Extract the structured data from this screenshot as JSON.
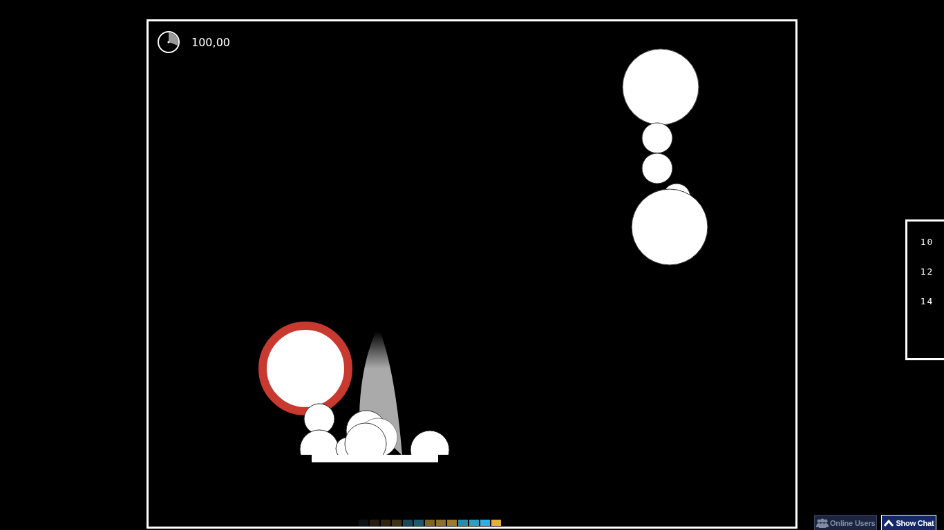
{
  "hud": {
    "timer": "100,00"
  },
  "scores": [
    "10",
    "12",
    "14"
  ],
  "swatches": [
    {
      "color": "#0a1418"
    },
    {
      "color": "#261d10"
    },
    {
      "color": "#2f2612"
    },
    {
      "color": "#3f3216"
    },
    {
      "color": "#1a4a5a"
    },
    {
      "color": "#1e5a6a"
    },
    {
      "color": "#7a6428"
    },
    {
      "color": "#8a7030"
    },
    {
      "color": "#9a7a30"
    },
    {
      "color": "#2a8aaa"
    },
    {
      "color": "#2aa0c8"
    },
    {
      "color": "#30b0e0"
    },
    {
      "color": "#e0b040"
    }
  ],
  "buttons": [
    {
      "kind": "users",
      "label": "Online Users",
      "disabled": true
    },
    {
      "kind": "chat",
      "label": "Show Chat",
      "disabled": false
    }
  ]
}
